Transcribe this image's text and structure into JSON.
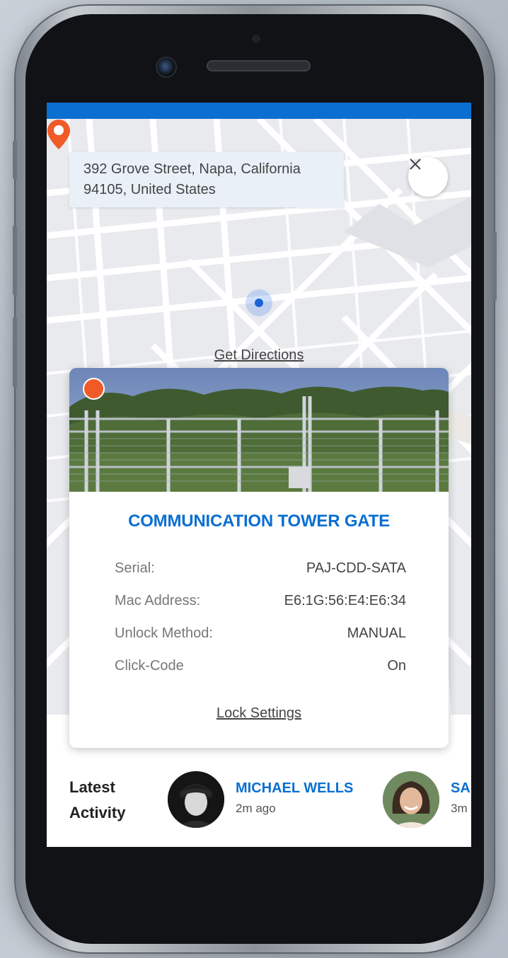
{
  "map": {
    "address": "392 Grove Street, Napa, California 94105, United States",
    "directions_label": "Get Directions",
    "close_icon": "close-icon",
    "pin_icon": "location-pin-icon"
  },
  "lock_card": {
    "title": "COMMUNICATION TOWER GATE",
    "status_color": "#f05a28",
    "details": [
      {
        "label": "Serial:",
        "value": "PAJ-CDD-SATA"
      },
      {
        "label": "Mac Address:",
        "value": "E6:1G:56:E4:E6:34"
      },
      {
        "label": "Unlock Method:",
        "value": "MANUAL"
      },
      {
        "label": "Click-Code",
        "value": "On"
      }
    ],
    "settings_label": "Lock Settings"
  },
  "activity": {
    "heading_line1": "Latest",
    "heading_line2": "Activity",
    "items": [
      {
        "name": "MICHAEL WELLS",
        "time": "2m ago"
      },
      {
        "name": "SA",
        "time": "3m"
      }
    ]
  },
  "colors": {
    "accent": "#0a6fd0",
    "status": "#f05a28"
  }
}
